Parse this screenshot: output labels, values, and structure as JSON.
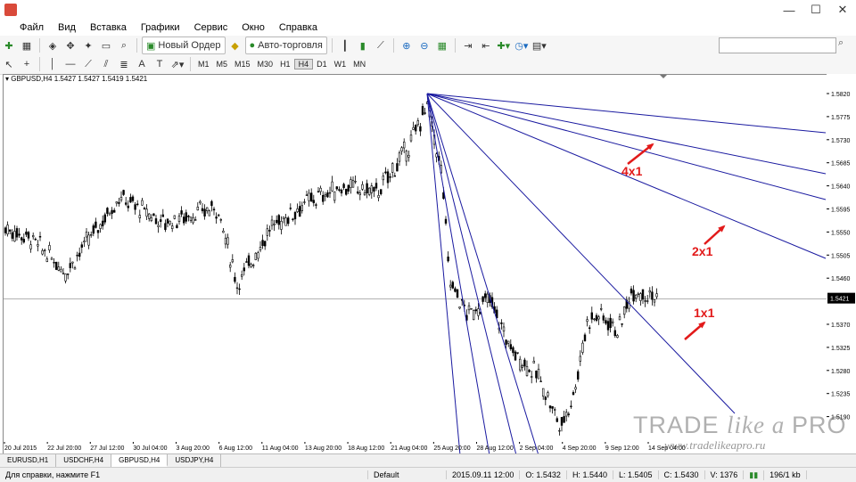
{
  "menu": [
    "Файл",
    "Вид",
    "Вставка",
    "Графики",
    "Сервис",
    "Окно",
    "Справка"
  ],
  "toolbar": {
    "new_order": "Новый Ордер",
    "autotrading": "Авто-торговля",
    "timeframes": [
      "M1",
      "M5",
      "M15",
      "M30",
      "H1",
      "H4",
      "D1",
      "W1",
      "MN"
    ],
    "active_timeframe": "H4"
  },
  "chart": {
    "symbol_info": "GBPUSD,H4  1.5427 1.5427 1.5419 1.5421",
    "current_price": "1.5421",
    "price_labels": [
      "1.5820",
      "1.5775",
      "1.5730",
      "1.5685",
      "1.5640",
      "1.5595",
      "1.5550",
      "1.5505",
      "1.5460",
      "1.5370",
      "1.5325",
      "1.5280",
      "1.5235",
      "1.5190"
    ],
    "time_labels": [
      "20 Jul 2015",
      "22 Jul 20:00",
      "27 Jul 12:00",
      "30 Jul 04:00",
      "3 Aug 20:00",
      "6 Aug 12:00",
      "11 Aug 04:00",
      "13 Aug 20:00",
      "18 Aug 12:00",
      "21 Aug 04:00",
      "25 Aug 20:00",
      "28 Aug 12:00",
      "2 Sep 04:00",
      "4 Sep 20:00",
      "9 Sep 12:00",
      "14 Sep 04:00"
    ],
    "annotations": {
      "a4x1": "4x1",
      "a2x1": "2x1",
      "a1x1": "1x1"
    },
    "colors": {
      "fan": "#1a1aa0",
      "candle": "#000000",
      "arrow": "#e21a1a"
    }
  },
  "tabs": [
    "EURUSD,H1",
    "USDCHF,H4",
    "GBPUSD,H4",
    "USDJPY,H4"
  ],
  "active_tab": "GBPUSD,H4",
  "status": {
    "help": "Для справки, нажмите F1",
    "profile": "Default",
    "time": "2015.09.11 12:00",
    "open": "O: 1.5432",
    "high": "H: 1.5440",
    "low": "L: 1.5405",
    "close": "C: 1.5430",
    "volume": "V: 1376",
    "traffic": "196/1 kb"
  },
  "watermark": {
    "brand_a": "TRADE ",
    "brand_b": "like a ",
    "brand_c": "PRO",
    "url": "www.tradelikeapro.ru"
  }
}
